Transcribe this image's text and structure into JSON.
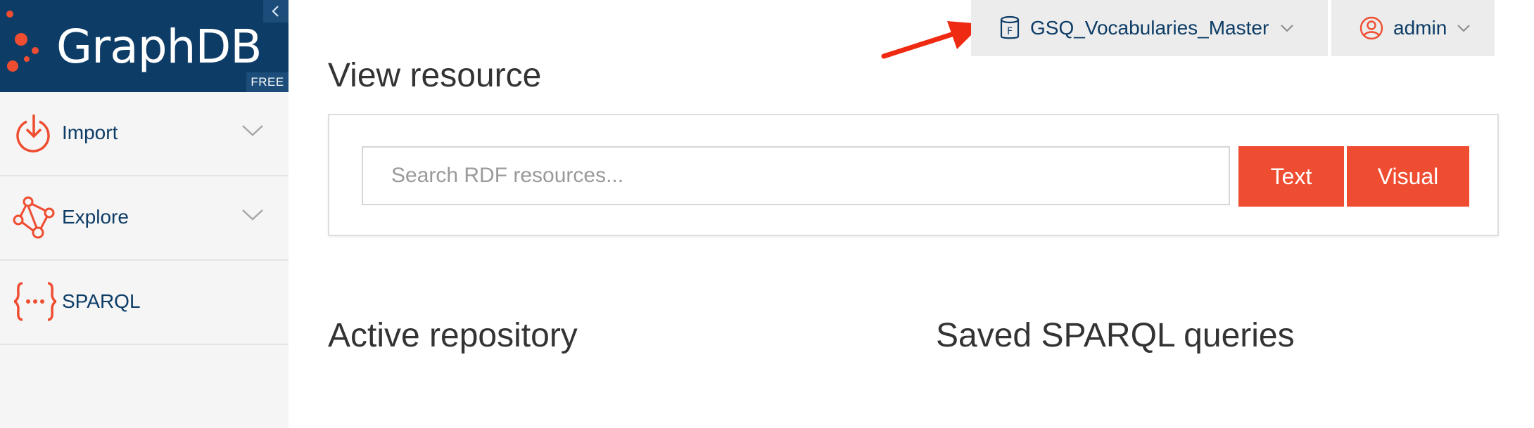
{
  "brand": {
    "name": "GraphDB",
    "badge": "FREE",
    "collapse_icon": "chevron-left-icon",
    "colors": {
      "header_bg": "#0d3c66",
      "accent": "#ef4d31"
    }
  },
  "sidebar": {
    "items": [
      {
        "label": "Import",
        "icon": "import-icon",
        "expandable": true
      },
      {
        "label": "Explore",
        "icon": "explore-graph-icon",
        "expandable": true
      },
      {
        "label": "SPARQL",
        "icon": "sparql-braces-icon",
        "expandable": false
      }
    ]
  },
  "topbar": {
    "repository": {
      "label": "GSQ_Vocabularies_Master",
      "icon": "repository-icon"
    },
    "user": {
      "label": "admin",
      "icon": "user-icon"
    }
  },
  "main": {
    "view_resource_title": "View resource",
    "search": {
      "placeholder": "Search RDF resources..."
    },
    "buttons": {
      "text": "Text",
      "visual": "Visual"
    },
    "active_repository_title": "Active repository",
    "saved_queries_title": "Saved SPARQL queries"
  }
}
